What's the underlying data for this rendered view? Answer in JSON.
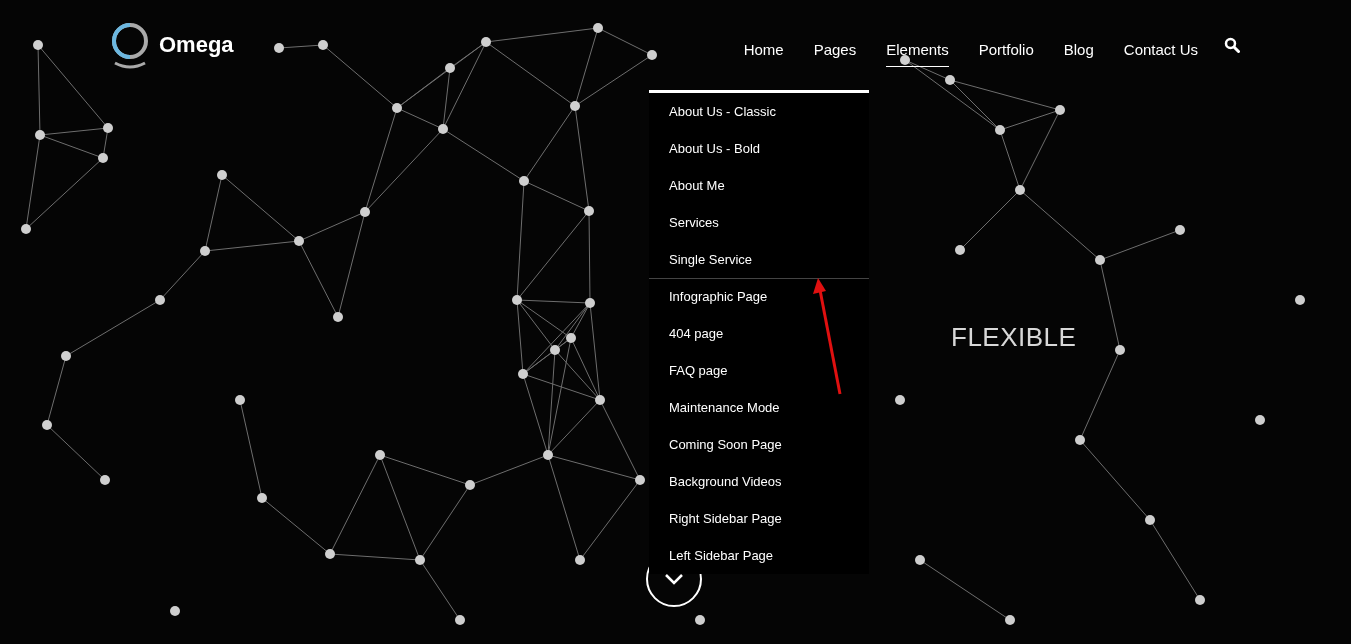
{
  "logo": {
    "text": "Omega"
  },
  "nav": [
    {
      "label": "Home",
      "selected": false
    },
    {
      "label": "Pages",
      "selected": false
    },
    {
      "label": "Elements",
      "selected": true
    },
    {
      "label": "Portfolio",
      "selected": false
    },
    {
      "label": "Blog",
      "selected": false
    },
    {
      "label": "Contact Us",
      "selected": false
    }
  ],
  "dropdown": [
    {
      "label": "About Us - Classic",
      "separated": false
    },
    {
      "label": "About Us - Bold",
      "separated": false
    },
    {
      "label": "About Me",
      "separated": false
    },
    {
      "label": "Services",
      "separated": false
    },
    {
      "label": "Single Service",
      "separated": false
    },
    {
      "label": "Infographic Page",
      "separated": true
    },
    {
      "label": "404 page",
      "separated": false
    },
    {
      "label": "FAQ page",
      "separated": false
    },
    {
      "label": "Maintenance Mode",
      "separated": false
    },
    {
      "label": "Coming Soon Page",
      "separated": false
    },
    {
      "label": "Background Videos",
      "separated": false
    },
    {
      "label": "Right Sidebar Page",
      "separated": false
    },
    {
      "label": "Left Sidebar Page",
      "separated": false
    }
  ],
  "hero": {
    "headline": "FLEXIBLE"
  }
}
